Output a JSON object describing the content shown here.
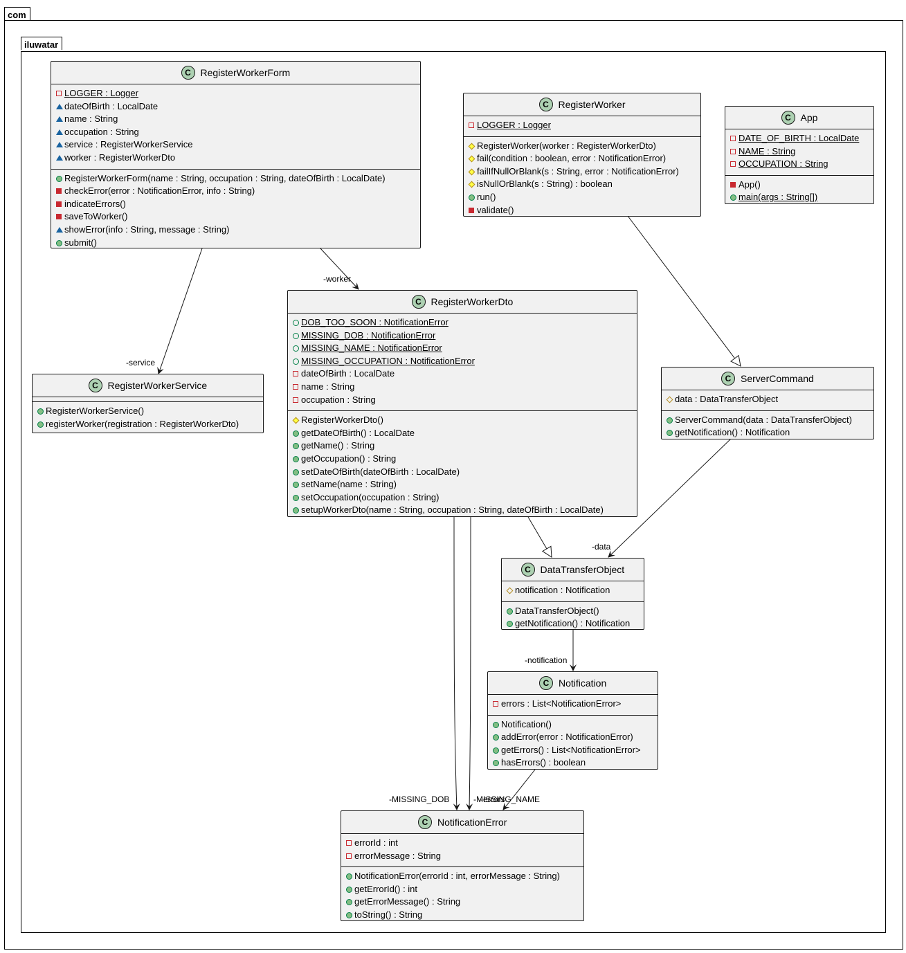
{
  "packages": {
    "outer": "com",
    "inner": "iluwatar"
  },
  "classes": {
    "registerWorkerForm": {
      "name": "RegisterWorkerForm",
      "fields": [
        {
          "vis": "private",
          "text": "LOGGER : Logger",
          "static": true
        },
        {
          "vis": "package",
          "text": "dateOfBirth : LocalDate"
        },
        {
          "vis": "package",
          "text": "name : String"
        },
        {
          "vis": "package",
          "text": "occupation : String"
        },
        {
          "vis": "package",
          "text": "service : RegisterWorkerService"
        },
        {
          "vis": "package",
          "text": "worker : RegisterWorkerDto"
        }
      ],
      "methods": [
        {
          "vis": "public",
          "text": "RegisterWorkerForm(name : String, occupation : String, dateOfBirth : LocalDate)"
        },
        {
          "vis": "private",
          "text": "checkError(error : NotificationError, info : String)"
        },
        {
          "vis": "private",
          "text": "indicateErrors()"
        },
        {
          "vis": "private",
          "text": "saveToWorker()"
        },
        {
          "vis": "package",
          "text": "showError(info : String, message : String)"
        },
        {
          "vis": "public",
          "text": "submit()"
        }
      ]
    },
    "registerWorker": {
      "name": "RegisterWorker",
      "fields": [
        {
          "vis": "private",
          "text": "LOGGER : Logger",
          "static": true
        }
      ],
      "methods": [
        {
          "vis": "protected",
          "text": "RegisterWorker(worker : RegisterWorkerDto)"
        },
        {
          "vis": "protected",
          "text": "fail(condition : boolean, error : NotificationError)"
        },
        {
          "vis": "protected",
          "text": "failIfNullOrBlank(s : String, error : NotificationError)"
        },
        {
          "vis": "protected",
          "text": "isNullOrBlank(s : String) : boolean"
        },
        {
          "vis": "public",
          "text": "run()"
        },
        {
          "vis": "private",
          "text": "validate()"
        }
      ]
    },
    "app": {
      "name": "App",
      "fields": [
        {
          "vis": "private",
          "text": "DATE_OF_BIRTH : LocalDate",
          "static": true
        },
        {
          "vis": "private",
          "text": "NAME : String",
          "static": true
        },
        {
          "vis": "private",
          "text": "OCCUPATION : String",
          "static": true
        }
      ],
      "methods": [
        {
          "vis": "private",
          "text": "App()"
        },
        {
          "vis": "public",
          "text": "main(args : String[])",
          "static": true
        }
      ]
    },
    "registerWorkerService": {
      "name": "RegisterWorkerService",
      "fields": [],
      "methods": [
        {
          "vis": "public",
          "text": "RegisterWorkerService()"
        },
        {
          "vis": "public",
          "text": "registerWorker(registration : RegisterWorkerDto)"
        }
      ]
    },
    "registerWorkerDto": {
      "name": "RegisterWorkerDto",
      "fields": [
        {
          "vis": "public",
          "text": "DOB_TOO_SOON : NotificationError",
          "static": true
        },
        {
          "vis": "public",
          "text": "MISSING_DOB : NotificationError",
          "static": true
        },
        {
          "vis": "public",
          "text": "MISSING_NAME : NotificationError",
          "static": true
        },
        {
          "vis": "public",
          "text": "MISSING_OCCUPATION : NotificationError",
          "static": true
        },
        {
          "vis": "private",
          "text": "dateOfBirth : LocalDate"
        },
        {
          "vis": "private",
          "text": "name : String"
        },
        {
          "vis": "private",
          "text": "occupation : String"
        }
      ],
      "methods": [
        {
          "vis": "protected",
          "text": "RegisterWorkerDto()"
        },
        {
          "vis": "public",
          "text": "getDateOfBirth() : LocalDate"
        },
        {
          "vis": "public",
          "text": "getName() : String"
        },
        {
          "vis": "public",
          "text": "getOccupation() : String"
        },
        {
          "vis": "public",
          "text": "setDateOfBirth(dateOfBirth : LocalDate)"
        },
        {
          "vis": "public",
          "text": "setName(name : String)"
        },
        {
          "vis": "public",
          "text": "setOccupation(occupation : String)"
        },
        {
          "vis": "public",
          "text": "setupWorkerDto(name : String, occupation : String, dateOfBirth : LocalDate)"
        }
      ]
    },
    "serverCommand": {
      "name": "ServerCommand",
      "fields": [
        {
          "vis": "protected",
          "text": "data : DataTransferObject"
        }
      ],
      "methods": [
        {
          "vis": "public",
          "text": "ServerCommand(data : DataTransferObject)"
        },
        {
          "vis": "public",
          "text": "getNotification() : Notification"
        }
      ]
    },
    "dataTransferObject": {
      "name": "DataTransferObject",
      "fields": [
        {
          "vis": "protected",
          "text": "notification : Notification"
        }
      ],
      "methods": [
        {
          "vis": "public",
          "text": "DataTransferObject()"
        },
        {
          "vis": "public",
          "text": "getNotification() : Notification"
        }
      ]
    },
    "notification": {
      "name": "Notification",
      "fields": [
        {
          "vis": "private",
          "text": "errors : List<NotificationError>"
        }
      ],
      "methods": [
        {
          "vis": "public",
          "text": "Notification()"
        },
        {
          "vis": "public",
          "text": "addError(error : NotificationError)"
        },
        {
          "vis": "public",
          "text": "getErrors() : List<NotificationError>"
        },
        {
          "vis": "public",
          "text": "hasErrors() : boolean"
        }
      ]
    },
    "notificationError": {
      "name": "NotificationError",
      "fields": [
        {
          "vis": "private",
          "text": "errorId : int"
        },
        {
          "vis": "private",
          "text": "errorMessage : String"
        }
      ],
      "methods": [
        {
          "vis": "public",
          "text": "NotificationError(errorId : int, errorMessage : String)"
        },
        {
          "vis": "public",
          "text": "getErrorId() : int"
        },
        {
          "vis": "public",
          "text": "getErrorMessage() : String"
        },
        {
          "vis": "public",
          "text": "toString() : String"
        }
      ]
    }
  },
  "edge_labels": {
    "worker": "-worker",
    "service": "-service",
    "data": "-data",
    "notification": "-notification",
    "missing_dob": "-MISSING_DOB",
    "missing_name": "-MISSING_NAME",
    "errors": "-errors"
  },
  "class_icon_letter": "C"
}
